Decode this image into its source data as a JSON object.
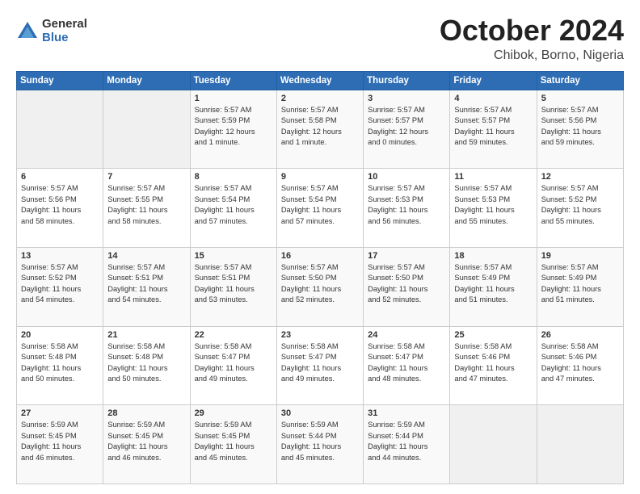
{
  "header": {
    "logo_general": "General",
    "logo_blue": "Blue",
    "title": "October 2024",
    "location": "Chibok, Borno, Nigeria"
  },
  "days_of_week": [
    "Sunday",
    "Monday",
    "Tuesday",
    "Wednesday",
    "Thursday",
    "Friday",
    "Saturday"
  ],
  "weeks": [
    [
      {
        "day": "",
        "info": ""
      },
      {
        "day": "",
        "info": ""
      },
      {
        "day": "1",
        "info": "Sunrise: 5:57 AM\nSunset: 5:59 PM\nDaylight: 12 hours\nand 1 minute."
      },
      {
        "day": "2",
        "info": "Sunrise: 5:57 AM\nSunset: 5:58 PM\nDaylight: 12 hours\nand 1 minute."
      },
      {
        "day": "3",
        "info": "Sunrise: 5:57 AM\nSunset: 5:57 PM\nDaylight: 12 hours\nand 0 minutes."
      },
      {
        "day": "4",
        "info": "Sunrise: 5:57 AM\nSunset: 5:57 PM\nDaylight: 11 hours\nand 59 minutes."
      },
      {
        "day": "5",
        "info": "Sunrise: 5:57 AM\nSunset: 5:56 PM\nDaylight: 11 hours\nand 59 minutes."
      }
    ],
    [
      {
        "day": "6",
        "info": "Sunrise: 5:57 AM\nSunset: 5:56 PM\nDaylight: 11 hours\nand 58 minutes."
      },
      {
        "day": "7",
        "info": "Sunrise: 5:57 AM\nSunset: 5:55 PM\nDaylight: 11 hours\nand 58 minutes."
      },
      {
        "day": "8",
        "info": "Sunrise: 5:57 AM\nSunset: 5:54 PM\nDaylight: 11 hours\nand 57 minutes."
      },
      {
        "day": "9",
        "info": "Sunrise: 5:57 AM\nSunset: 5:54 PM\nDaylight: 11 hours\nand 57 minutes."
      },
      {
        "day": "10",
        "info": "Sunrise: 5:57 AM\nSunset: 5:53 PM\nDaylight: 11 hours\nand 56 minutes."
      },
      {
        "day": "11",
        "info": "Sunrise: 5:57 AM\nSunset: 5:53 PM\nDaylight: 11 hours\nand 55 minutes."
      },
      {
        "day": "12",
        "info": "Sunrise: 5:57 AM\nSunset: 5:52 PM\nDaylight: 11 hours\nand 55 minutes."
      }
    ],
    [
      {
        "day": "13",
        "info": "Sunrise: 5:57 AM\nSunset: 5:52 PM\nDaylight: 11 hours\nand 54 minutes."
      },
      {
        "day": "14",
        "info": "Sunrise: 5:57 AM\nSunset: 5:51 PM\nDaylight: 11 hours\nand 54 minutes."
      },
      {
        "day": "15",
        "info": "Sunrise: 5:57 AM\nSunset: 5:51 PM\nDaylight: 11 hours\nand 53 minutes."
      },
      {
        "day": "16",
        "info": "Sunrise: 5:57 AM\nSunset: 5:50 PM\nDaylight: 11 hours\nand 52 minutes."
      },
      {
        "day": "17",
        "info": "Sunrise: 5:57 AM\nSunset: 5:50 PM\nDaylight: 11 hours\nand 52 minutes."
      },
      {
        "day": "18",
        "info": "Sunrise: 5:57 AM\nSunset: 5:49 PM\nDaylight: 11 hours\nand 51 minutes."
      },
      {
        "day": "19",
        "info": "Sunrise: 5:57 AM\nSunset: 5:49 PM\nDaylight: 11 hours\nand 51 minutes."
      }
    ],
    [
      {
        "day": "20",
        "info": "Sunrise: 5:58 AM\nSunset: 5:48 PM\nDaylight: 11 hours\nand 50 minutes."
      },
      {
        "day": "21",
        "info": "Sunrise: 5:58 AM\nSunset: 5:48 PM\nDaylight: 11 hours\nand 50 minutes."
      },
      {
        "day": "22",
        "info": "Sunrise: 5:58 AM\nSunset: 5:47 PM\nDaylight: 11 hours\nand 49 minutes."
      },
      {
        "day": "23",
        "info": "Sunrise: 5:58 AM\nSunset: 5:47 PM\nDaylight: 11 hours\nand 49 minutes."
      },
      {
        "day": "24",
        "info": "Sunrise: 5:58 AM\nSunset: 5:47 PM\nDaylight: 11 hours\nand 48 minutes."
      },
      {
        "day": "25",
        "info": "Sunrise: 5:58 AM\nSunset: 5:46 PM\nDaylight: 11 hours\nand 47 minutes."
      },
      {
        "day": "26",
        "info": "Sunrise: 5:58 AM\nSunset: 5:46 PM\nDaylight: 11 hours\nand 47 minutes."
      }
    ],
    [
      {
        "day": "27",
        "info": "Sunrise: 5:59 AM\nSunset: 5:45 PM\nDaylight: 11 hours\nand 46 minutes."
      },
      {
        "day": "28",
        "info": "Sunrise: 5:59 AM\nSunset: 5:45 PM\nDaylight: 11 hours\nand 46 minutes."
      },
      {
        "day": "29",
        "info": "Sunrise: 5:59 AM\nSunset: 5:45 PM\nDaylight: 11 hours\nand 45 minutes."
      },
      {
        "day": "30",
        "info": "Sunrise: 5:59 AM\nSunset: 5:44 PM\nDaylight: 11 hours\nand 45 minutes."
      },
      {
        "day": "31",
        "info": "Sunrise: 5:59 AM\nSunset: 5:44 PM\nDaylight: 11 hours\nand 44 minutes."
      },
      {
        "day": "",
        "info": ""
      },
      {
        "day": "",
        "info": ""
      }
    ]
  ]
}
